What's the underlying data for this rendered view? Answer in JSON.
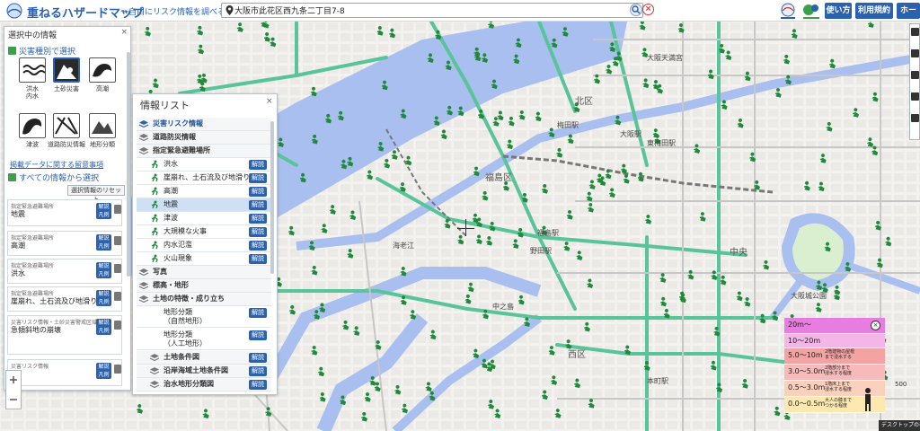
{
  "header": {
    "title": "重ねるハザードマップ",
    "subtitle": "〜自由にリスク情報を調べる〜",
    "search_value": "大阪市此花区西九条二丁目7-8",
    "btn_howto": "使い方",
    "btn_terms": "利用規約",
    "btn_more": "ホー"
  },
  "left_panel": {
    "title": "選択中の情報",
    "hazard_header": "災害種別で選択",
    "hazards": [
      {
        "label": "洪水",
        "sub": "内水",
        "icon": "flood-icon"
      },
      {
        "label": "土砂災害",
        "sub": "",
        "icon": "landslide-icon",
        "selected": true
      },
      {
        "label": "高潮",
        "sub": "",
        "icon": "storm-surge-icon"
      },
      {
        "label": "津波",
        "sub": "",
        "icon": "tsunami-icon"
      },
      {
        "label": "道路防災情報",
        "sub": "",
        "icon": "road-icon"
      },
      {
        "label": "地形分類",
        "sub": "",
        "icon": "terrain-icon"
      }
    ],
    "note_link": "掲載データに関する留意事項",
    "all_header": "すべての情報から選択",
    "reset_label": "選択情報のリセット",
    "selected_items": [
      {
        "category": "指定緊急避難場所",
        "name": "地震"
      },
      {
        "category": "指定緊急避難場所",
        "name": "高潮"
      },
      {
        "category": "指定緊急避難場所",
        "name": "洪水"
      },
      {
        "category": "指定緊急避難場所",
        "name": "崖崩れ、土石流及び地滑り"
      },
      {
        "category": "災害リスク情報・土砂災害警戒区域",
        "name": "急傾斜地の崩壊"
      },
      {
        "category": "災害リスク情報",
        "name": ""
      }
    ],
    "legend_btn": "解説\n凡例"
  },
  "info_panel": {
    "title": "情報リスト",
    "rows": [
      {
        "kind": "cat",
        "text": "災害リスク情報",
        "blue": true
      },
      {
        "kind": "cat",
        "text": "道路防災情報"
      },
      {
        "kind": "cat",
        "text": "指定緊急避難場所"
      },
      {
        "kind": "sub",
        "text": "洪水",
        "btn": "解説"
      },
      {
        "kind": "sub",
        "text": "崖崩れ、土石流及び地滑り",
        "btn": "解説"
      },
      {
        "kind": "sub",
        "text": "高潮",
        "btn": "解説"
      },
      {
        "kind": "sub",
        "text": "地震",
        "btn": "解説",
        "highlight": true
      },
      {
        "kind": "sub",
        "text": "津波",
        "btn": "解説"
      },
      {
        "kind": "sub",
        "text": "大規模な火事",
        "btn": "解説"
      },
      {
        "kind": "sub",
        "text": "内水氾濫",
        "btn": "解説"
      },
      {
        "kind": "sub",
        "text": "火山現象",
        "btn": "解説"
      },
      {
        "kind": "cat",
        "text": "写真"
      },
      {
        "kind": "cat",
        "text": "標高・地形"
      },
      {
        "kind": "cat",
        "text": "土地の特徴・成り立ち"
      },
      {
        "kind": "tall",
        "text": "地形分類\n（自然地形）",
        "btn": "解説"
      },
      {
        "kind": "tall",
        "text": "地形分類\n（人工地形）",
        "btn": "解説"
      },
      {
        "kind": "cat2",
        "text": "土地条件図",
        "btn": "解説"
      },
      {
        "kind": "cat2",
        "text": "沿岸海域土地条件図",
        "btn": "解説"
      },
      {
        "kind": "cat2",
        "text": "治水地形分類図",
        "btn": "解説"
      }
    ]
  },
  "map_labels": [
    {
      "text": "北区",
      "cls": "big",
      "pos": "a"
    },
    {
      "text": "福島区",
      "cls": "big",
      "pos": "b"
    },
    {
      "text": "中央",
      "cls": "big",
      "pos": "c"
    },
    {
      "text": "西区",
      "cls": "big",
      "pos": "d"
    },
    {
      "text": "大阪城公園",
      "cls": "",
      "pos": "e"
    },
    {
      "text": "福島駅",
      "cls": "",
      "pos": "f"
    },
    {
      "text": "野田駅",
      "cls": "",
      "pos": "g"
    },
    {
      "text": "海老江",
      "cls": "",
      "pos": "h"
    },
    {
      "text": "大阪駅",
      "cls": "",
      "pos": "i"
    },
    {
      "text": "東梅田駅",
      "cls": "",
      "pos": "j"
    },
    {
      "text": "梅田駅",
      "cls": "",
      "pos": "k"
    },
    {
      "text": "大阪天満宮",
      "cls": "",
      "pos": "l"
    },
    {
      "text": "中之島",
      "cls": "",
      "pos": "m"
    },
    {
      "text": "本町駅",
      "cls": "",
      "pos": "n"
    }
  ],
  "depth_legend": {
    "rows": [
      {
        "v": "20m〜",
        "d": "",
        "color": "#e77de0"
      },
      {
        "v": "10〜20m",
        "d": "",
        "color": "#f3b6e6"
      },
      {
        "v": "5.0〜10m",
        "d": "2階建物の屋根\nまで浸水する",
        "color": "#f4a3a3"
      },
      {
        "v": "3.0〜5.0m",
        "d": "2階部分まで\n浸水する程度",
        "color": "#f7baba"
      },
      {
        "v": "0.5〜3.0m",
        "d": "1階床上まで\n浸水する程度",
        "color": "#fbd0bd"
      },
      {
        "v": "0.0〜0.5m",
        "d": "大人の膝まで\nつかる程度",
        "color": "#fde8b0"
      }
    ]
  },
  "misc": {
    "desktop_link": "デスクトップの表",
    "scale": "500"
  }
}
